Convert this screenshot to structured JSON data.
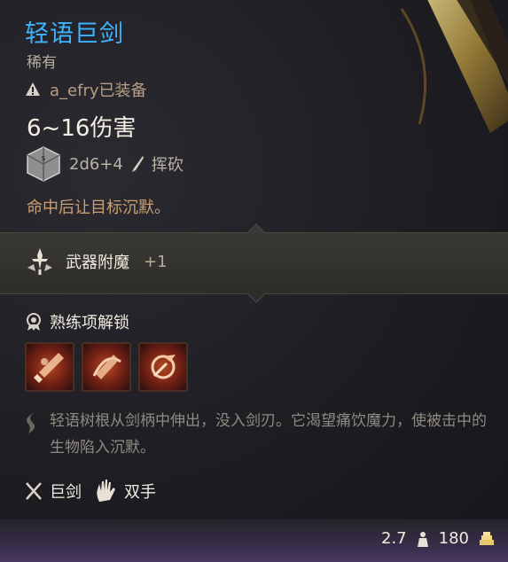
{
  "item": {
    "name": "轻语巨剑",
    "rarity": "稀有",
    "equipped_by": "a_efry已装备",
    "damage": "6~16伤害",
    "dice": "2d6+4",
    "damage_type": "挥砍",
    "effect": "命中后让目标沉默。"
  },
  "enchantment": {
    "label": "武器附魔",
    "bonus": "+1"
  },
  "proficiency": {
    "label": "熟练项解锁",
    "actions": [
      {
        "name": "action-icon-1"
      },
      {
        "name": "action-icon-2"
      },
      {
        "name": "action-icon-3"
      }
    ]
  },
  "description": "轻语树根从剑柄中伸出，没入剑刃。它渴望痛饮魔力，使被击中的生物陷入沉默。",
  "tags": [
    {
      "label": "巨剑",
      "icon": "greatsword-icon"
    },
    {
      "label": "双手",
      "icon": "two-handed-icon"
    }
  ],
  "footer": {
    "weight": "2.7",
    "value": "180"
  },
  "colors": {
    "title": "#3fb3ff",
    "effect": "#c9a074",
    "rarity": "#b6ad9f"
  }
}
